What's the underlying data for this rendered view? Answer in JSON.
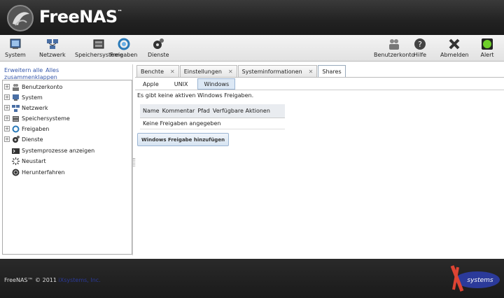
{
  "header": {
    "brand": "FreeNAS",
    "tm": "™"
  },
  "toolbar": {
    "left": [
      {
        "label": "System",
        "icon": "system-icon"
      },
      {
        "label": "Netzwerk",
        "icon": "network-icon"
      },
      {
        "label": "Speichersysteme",
        "icon": "storage-icon"
      },
      {
        "label": "Freigaben",
        "icon": "shares-icon"
      },
      {
        "label": "Dienste",
        "icon": "services-icon"
      }
    ],
    "right": [
      {
        "label": "Benutzerkonto",
        "icon": "users-icon"
      },
      {
        "label": "Hilfe",
        "icon": "help-icon"
      },
      {
        "label": "Abmelden",
        "icon": "logout-icon"
      },
      {
        "label": "Alert",
        "icon": "alert-icon",
        "color": "#6ecf2a"
      }
    ]
  },
  "sidebar": {
    "expand_all": "Erweitern alle",
    "collapse_all_1": "Alles",
    "collapse_all_2": "zusammenklappen",
    "items": [
      {
        "label": "Benutzerkonto",
        "expandable": true
      },
      {
        "label": "System",
        "expandable": true
      },
      {
        "label": "Netzwerk",
        "expandable": true
      },
      {
        "label": "Speichersysteme",
        "expandable": true
      },
      {
        "label": "Freigaben",
        "expandable": true
      },
      {
        "label": "Dienste",
        "expandable": true
      },
      {
        "label": "Systemprozesse anzeigen",
        "expandable": false
      },
      {
        "label": "Neustart",
        "expandable": false
      },
      {
        "label": "Herunterfahren",
        "expandable": false
      }
    ]
  },
  "tabs": [
    {
      "label": "Benchte",
      "closable": true
    },
    {
      "label": "Einstellungen",
      "closable": true
    },
    {
      "label": "Systeminformationen",
      "closable": true
    },
    {
      "label": "Shares",
      "closable": false,
      "active": true
    }
  ],
  "subtabs": [
    {
      "label": "Apple"
    },
    {
      "label": "UNIX"
    },
    {
      "label": "Windows",
      "active": true
    }
  ],
  "content": {
    "message": "Es gibt keine aktiven Windows Freigaben.",
    "columns": [
      "Name",
      "Kommentar",
      "Pfad",
      "Verfügbare Aktionen"
    ],
    "empty_row": "Keine Freigaben angegeben",
    "add_button": "Windows Freigabe hinzufügen"
  },
  "footer": {
    "copyright": "FreeNAS™ © 2011 ",
    "company": "iXsystems, Inc.",
    "logo_text": "systems"
  }
}
